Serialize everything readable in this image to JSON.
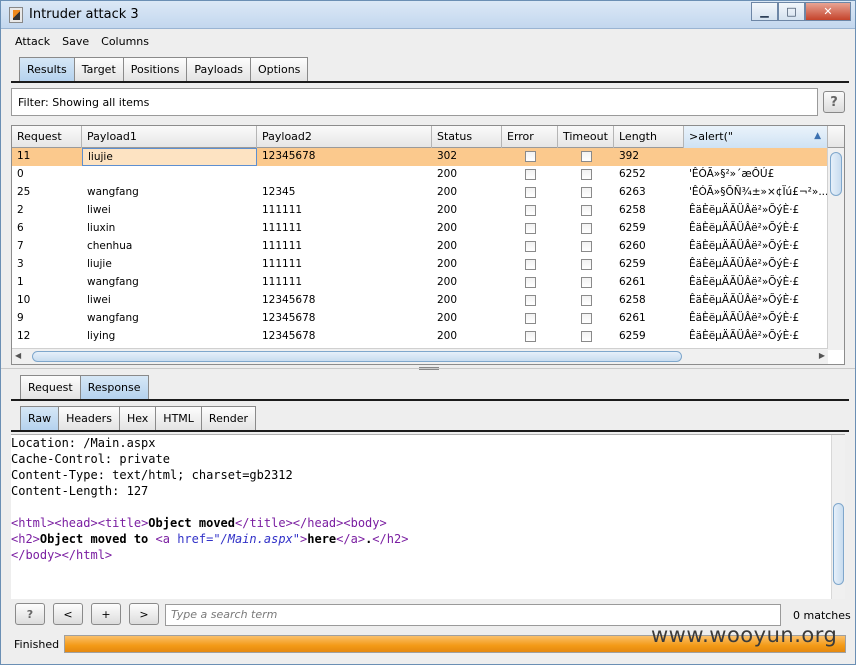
{
  "window": {
    "title": "Intruder attack 3"
  },
  "menu": [
    "Attack",
    "Save",
    "Columns"
  ],
  "main_tabs": [
    {
      "label": "Results",
      "active": true
    },
    {
      "label": "Target",
      "active": false
    },
    {
      "label": "Positions",
      "active": false
    },
    {
      "label": "Payloads",
      "active": false
    },
    {
      "label": "Options",
      "active": false
    }
  ],
  "filter": {
    "text": "Filter:  Showing all items"
  },
  "help_label": "?",
  "table": {
    "columns": [
      "Request",
      "Payload1",
      "Payload2",
      "Status",
      "Error",
      "Timeout",
      "Length",
      ">alert(\""
    ],
    "sorted_column": ">alert(\"",
    "rows": [
      {
        "request": "11",
        "payload1": "liujie",
        "payload2": "12345678",
        "status": "302",
        "error": false,
        "timeout": false,
        "length": "392",
        "alert": "",
        "selected": true
      },
      {
        "request": "0",
        "payload1": "",
        "payload2": "",
        "status": "200",
        "error": false,
        "timeout": false,
        "length": "6252",
        "alert": "'ÊÓÃ»§²»´æÔÚ£"
      },
      {
        "request": "25",
        "payload1": "wangfang",
        "payload2": "12345",
        "status": "200",
        "error": false,
        "timeout": false,
        "length": "6263",
        "alert": "'ÊÓÃ»§ÕÑ¾­±»×¢Ïú£¬²»..."
      },
      {
        "request": "2",
        "payload1": "liwei",
        "payload2": "111111",
        "status": "200",
        "error": false,
        "timeout": false,
        "length": "6258",
        "alert": "ÊäÈëµÄÃÜÂë²»ÕýÈ·£"
      },
      {
        "request": "6",
        "payload1": "liuxin",
        "payload2": "111111",
        "status": "200",
        "error": false,
        "timeout": false,
        "length": "6259",
        "alert": "ÊäÈëµÄÃÜÂë²»ÕýÈ·£"
      },
      {
        "request": "7",
        "payload1": "chenhua",
        "payload2": "111111",
        "status": "200",
        "error": false,
        "timeout": false,
        "length": "6260",
        "alert": "ÊäÈëµÄÃÜÂë²»ÕýÈ·£"
      },
      {
        "request": "3",
        "payload1": "liujie",
        "payload2": "111111",
        "status": "200",
        "error": false,
        "timeout": false,
        "length": "6259",
        "alert": "ÊäÈëµÄÃÜÂë²»ÕýÈ·£"
      },
      {
        "request": "1",
        "payload1": "wangfang",
        "payload2": "111111",
        "status": "200",
        "error": false,
        "timeout": false,
        "length": "6261",
        "alert": "ÊäÈëµÄÃÜÂë²»ÕýÈ·£"
      },
      {
        "request": "10",
        "payload1": "liwei",
        "payload2": "12345678",
        "status": "200",
        "error": false,
        "timeout": false,
        "length": "6258",
        "alert": "ÊäÈëµÄÃÜÂë²»ÕýÈ·£"
      },
      {
        "request": "9",
        "payload1": "wangfang",
        "payload2": "12345678",
        "status": "200",
        "error": false,
        "timeout": false,
        "length": "6261",
        "alert": "ÊäÈëµÄÃÜÂë²»ÕýÈ·£"
      },
      {
        "request": "12",
        "payload1": "liying",
        "payload2": "12345678",
        "status": "200",
        "error": false,
        "timeout": false,
        "length": "6259",
        "alert": "ÊäÈëµÄÃÜÂë²»ÕýÈ·£"
      }
    ]
  },
  "req_resp_tabs": [
    {
      "label": "Request",
      "active": false
    },
    {
      "label": "Response",
      "active": true
    }
  ],
  "view_tabs": [
    {
      "label": "Raw",
      "active": true
    },
    {
      "label": "Headers",
      "active": false
    },
    {
      "label": "Hex",
      "active": false
    },
    {
      "label": "HTML",
      "active": false
    },
    {
      "label": "Render",
      "active": false
    }
  ],
  "response": {
    "headers": [
      "Location: /Main.aspx",
      "Cache-Control: private",
      "Content-Type: text/html; charset=gb2312",
      "Content-Length: 127"
    ],
    "body_line1": {
      "t1": "<html>",
      "t2": "<head>",
      "t3": "<title>",
      "text": "Object moved",
      "t4": "</title>",
      "t5": "</head>",
      "t6": "<body>"
    },
    "body_line2": {
      "t1": "<h2>",
      "text1": "Object moved to ",
      "t2a": "<a ",
      "attr": "href=",
      "val": "\"/Main.aspx\"",
      "t2b": ">",
      "text2": "here",
      "t3": "</a>",
      "text3": ".",
      "t4": "</h2>"
    },
    "body_line3": {
      "t1": "</body>",
      "t2": "</html>"
    }
  },
  "search": {
    "help_label": "?",
    "prev_label": "<",
    "add_label": "+",
    "next_label": ">",
    "placeholder": "Type a search term",
    "matches": "0 matches"
  },
  "status": {
    "text": "Finished",
    "progress": 1.0
  },
  "watermark": "www.wooyun.org"
}
